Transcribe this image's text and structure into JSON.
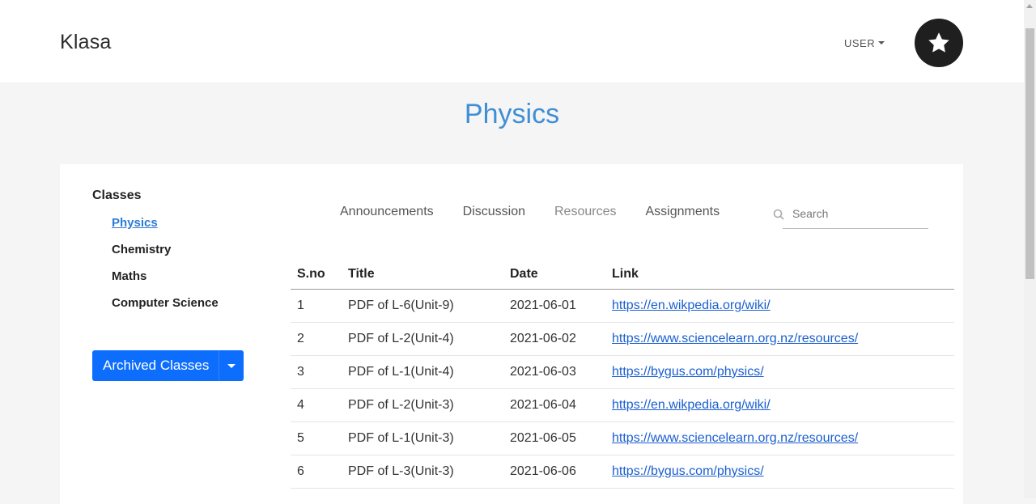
{
  "header": {
    "brand": "Klasa",
    "user_menu_label": "USER"
  },
  "page_title": "Physics",
  "sidebar": {
    "title": "Classes",
    "classes": [
      {
        "label": "Physics",
        "active": true
      },
      {
        "label": "Chemistry",
        "active": false
      },
      {
        "label": "Maths",
        "active": false
      },
      {
        "label": "Computer Science",
        "active": false
      }
    ],
    "archived_button": "Archived Classes"
  },
  "tabs": [
    {
      "label": "Announcements"
    },
    {
      "label": "Discussion"
    },
    {
      "label": "Resources"
    },
    {
      "label": "Assignments"
    }
  ],
  "search": {
    "placeholder": "Search",
    "value": ""
  },
  "table": {
    "headers": [
      "S.no",
      "Title",
      "Date",
      "Link"
    ],
    "rows": [
      {
        "sno": "1",
        "title": "PDF of L-6(Unit-9)",
        "date": "2021-06-01",
        "link": "https://en.wikpedia.org/wiki/"
      },
      {
        "sno": "2",
        "title": "PDF of L-2(Unit-4)",
        "date": "2021-06-02",
        "link": "https://www.sciencelearn.org.nz/resources/"
      },
      {
        "sno": "3",
        "title": "PDF of L-1(Unit-4)",
        "date": "2021-06-03",
        "link": "https://bygus.com/physics/"
      },
      {
        "sno": "4",
        "title": "PDF of L-2(Unit-3)",
        "date": "2021-06-04",
        "link": "https://en.wikpedia.org/wiki/"
      },
      {
        "sno": "5",
        "title": "PDF of L-1(Unit-3)",
        "date": "2021-06-05",
        "link": "https://www.sciencelearn.org.nz/resources/"
      },
      {
        "sno": "6",
        "title": "PDF of L-3(Unit-3)",
        "date": "2021-06-06",
        "link": "https://bygus.com/physics/"
      }
    ]
  },
  "icons": {
    "star": "star-icon",
    "search": "search-icon",
    "caret": "chevron-down-icon"
  },
  "colors": {
    "accent": "#3f8fd6",
    "primary_button": "#0d6efd",
    "link": "#1a5fd0"
  }
}
